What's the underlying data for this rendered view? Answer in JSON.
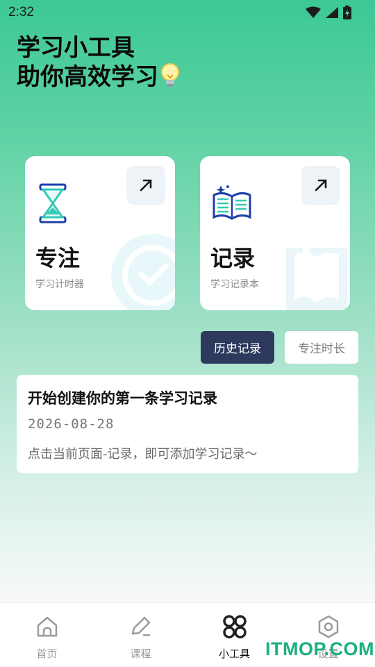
{
  "status": {
    "time": "2:32"
  },
  "hero": {
    "line1": "学习小工具",
    "line2": "助你高效学习"
  },
  "cards": {
    "focus": {
      "title": "专注",
      "subtitle": "学习计时器"
    },
    "record": {
      "title": "记录",
      "subtitle": "学习记录本"
    }
  },
  "buttons": {
    "history": "历史记录",
    "duration": "专注时长"
  },
  "record_item": {
    "title": "开始创建你的第一条学习记录",
    "date": "2026-08-28",
    "hint": "点击当前页面-记录，即可添加学习记录～"
  },
  "tabs": [
    {
      "label": "首页",
      "icon": "home-icon",
      "active": false
    },
    {
      "label": "课程",
      "icon": "edit-icon",
      "active": false
    },
    {
      "label": "小工具",
      "icon": "tools-icon",
      "active": true
    },
    {
      "label": "设置",
      "icon": "settings-icon",
      "active": false
    }
  ],
  "watermark": "ITMOP.COM",
  "colors": {
    "accent_green": "#3cc896",
    "dark_button": "#2d3a5e",
    "watermark": "#1bb07a"
  }
}
